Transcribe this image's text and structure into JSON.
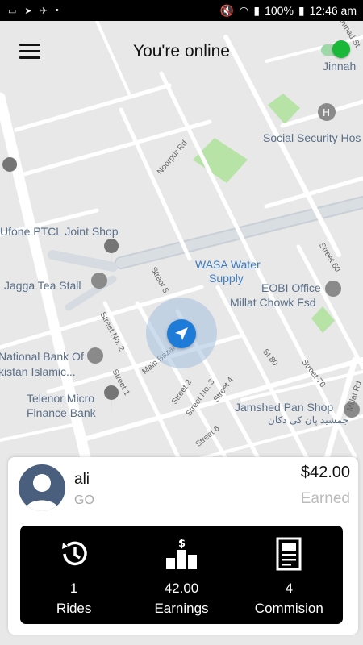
{
  "status_bar": {
    "battery": "100%",
    "time": "12:46 am"
  },
  "header": {
    "title": "You're online"
  },
  "map": {
    "labels": {
      "ahmad_st": "Ahmad St",
      "jinnah": "Jinnah",
      "social_security": "Social Security Hos",
      "noorpur_rd": "Noorpur Rd",
      "ufone": "Ufone PTCL Joint Shop",
      "jagga": "Jagga Tea Stall",
      "wasa_line1": "WASA Water",
      "wasa_line2": "Supply",
      "street_60": "Street 60",
      "eobi": "EOBI Office",
      "millat_chowk": "Millat Chowk Fsd",
      "street_5": "Street 5",
      "street_no2": "Street No. 2",
      "main_bazar": "Main Bazar",
      "national_bank_line1": "National Bank Of",
      "national_bank_line2": "kistan Islamic...",
      "street_1": "Street 1",
      "st_80": "St 80",
      "street_70": "Street 70",
      "millat_rd": "Millat Rd",
      "street_2": "Street 2",
      "street_no3": "Street No. 3",
      "street_4": "Street 4",
      "telenor_line1": "Telenor Micro",
      "telenor_line2": "Finance Bank",
      "jamshed_line1": "Jamshed Pan Shop",
      "jamshed_line2": "جمشید پان کی دکان",
      "street_6": "Street 6"
    }
  },
  "driver": {
    "name": "ali",
    "subtitle": "GO",
    "amount": "$42.00",
    "amount_label": "Earned"
  },
  "stats": [
    {
      "value": "1",
      "label": "Rides",
      "icon": "history-icon"
    },
    {
      "value": "42.00",
      "label": "Earnings",
      "icon": "earnings-podium-icon"
    },
    {
      "value": "4",
      "label": "Commision",
      "icon": "commission-receipt-icon"
    }
  ],
  "colors": {
    "online_green": "#19b839",
    "location_blue": "#1f7bd8",
    "avatar_bg": "#4a5e7d",
    "stats_bg": "#000000"
  }
}
